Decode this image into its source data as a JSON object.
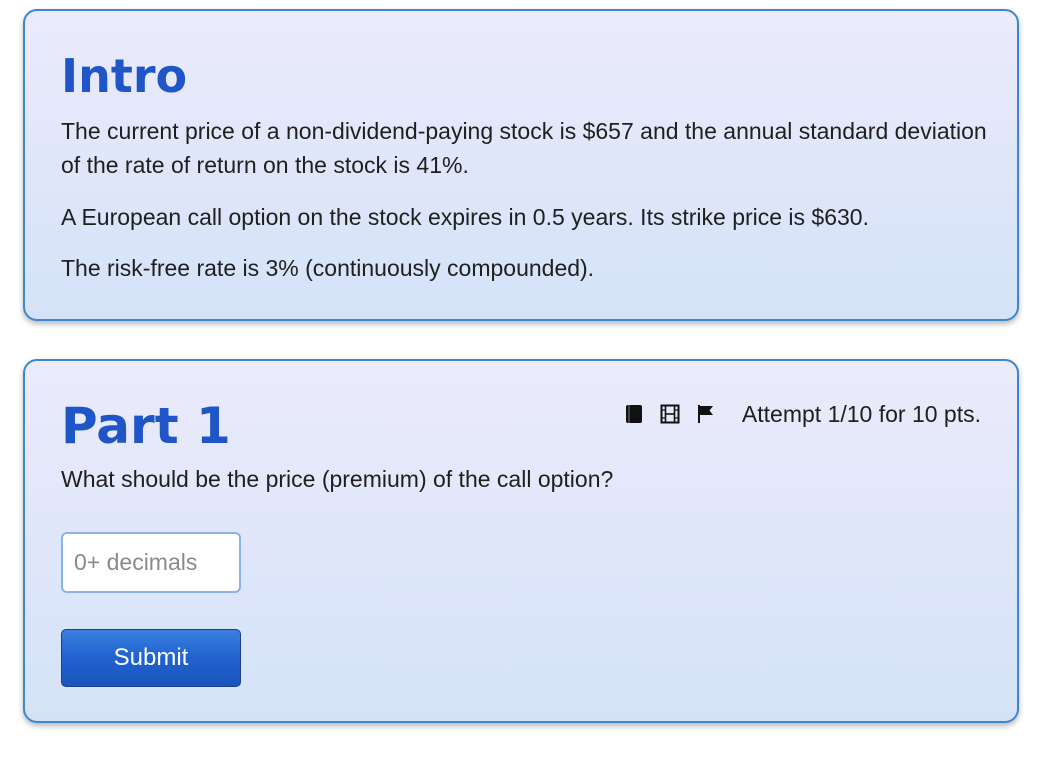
{
  "intro": {
    "title": "Intro",
    "paragraphs": [
      "The current price of a non-dividend-paying stock is $657 and the annual standard deviation of the rate of return on the stock is 41%.",
      "A European call option on the stock expires in 0.5 years. Its strike price is $630.",
      "The risk-free rate is 3% (continuously compounded)."
    ]
  },
  "part": {
    "title": "Part 1",
    "question": "What should be the price (premium) of the call option?",
    "attempt_text": "Attempt 1/10 for 10 pts.",
    "toolbar_icons": [
      "book-icon",
      "film-icon",
      "flag-icon"
    ],
    "answer": {
      "value": "",
      "placeholder": "0+ decimals"
    },
    "submit_label": "Submit"
  },
  "colors": {
    "heading": "#1f55c6",
    "card_border": "#3d86d0",
    "button": "#2062cf"
  }
}
